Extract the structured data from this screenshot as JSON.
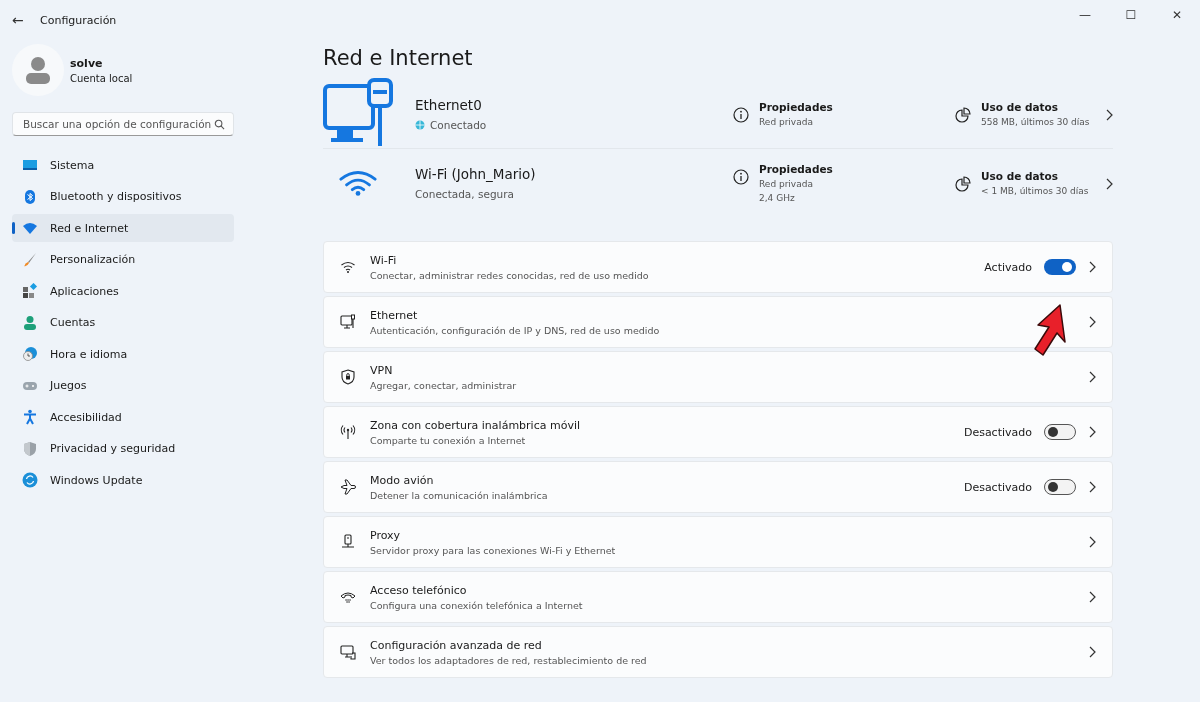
{
  "window": {
    "title": "Configuración",
    "back": "←",
    "controls": [
      "—",
      "☐",
      "✕"
    ]
  },
  "profile": {
    "name": "solve",
    "account": "Cuenta local"
  },
  "search": {
    "placeholder": "Buscar una opción de configuración"
  },
  "sidebar": {
    "items": [
      {
        "label": "Sistema",
        "selected": false
      },
      {
        "label": "Bluetooth y dispositivos",
        "selected": false
      },
      {
        "label": "Red e Internet",
        "selected": true
      },
      {
        "label": "Personalización",
        "selected": false
      },
      {
        "label": "Aplicaciones",
        "selected": false
      },
      {
        "label": "Cuentas",
        "selected": false
      },
      {
        "label": "Hora e idioma",
        "selected": false
      },
      {
        "label": "Juegos",
        "selected": false
      },
      {
        "label": "Accesibilidad",
        "selected": false
      },
      {
        "label": "Privacidad y seguridad",
        "selected": false
      },
      {
        "label": "Windows Update",
        "selected": false
      }
    ]
  },
  "page_title": "Red e Internet",
  "connections": [
    {
      "kind": "ethernet",
      "name": "Ethernet0",
      "status": "Conectado",
      "properties_label": "Propiedades",
      "properties": [
        "Red privada"
      ],
      "usage_label": "Uso de datos",
      "usage": "558 MB, últimos 30 días"
    },
    {
      "kind": "wifi",
      "name": "Wi-Fi (John_Mario)",
      "status": "Conectada, segura",
      "properties_label": "Propiedades",
      "properties": [
        "Red privada",
        "2,4 GHz"
      ],
      "usage_label": "Uso de datos",
      "usage": "< 1 MB, últimos 30 días"
    }
  ],
  "settings": [
    {
      "kind": "toggle",
      "title": "Wi-Fi",
      "subtitle": "Conectar, administrar redes conocidas, red de uso medido",
      "status": "Activado",
      "on": true
    },
    {
      "kind": "link",
      "title": "Ethernet",
      "subtitle": "Autenticación, configuración de IP y DNS, red de uso medido"
    },
    {
      "kind": "link",
      "title": "VPN",
      "subtitle": "Agregar, conectar, administrar"
    },
    {
      "kind": "toggle",
      "title": "Zona con cobertura inalámbrica móvil",
      "subtitle": "Comparte tu conexión a Internet",
      "status": "Desactivado",
      "on": false
    },
    {
      "kind": "toggle",
      "title": "Modo avión",
      "subtitle": "Detener la comunicación inalámbrica",
      "status": "Desactivado",
      "on": false
    },
    {
      "kind": "link",
      "title": "Proxy",
      "subtitle": "Servidor proxy para las conexiones Wi-Fi y Ethernet"
    },
    {
      "kind": "link",
      "title": "Acceso telefónico",
      "subtitle": "Configura una conexión telefónica a Internet"
    },
    {
      "kind": "link",
      "title": "Configuración avanzada de red",
      "subtitle": "Ver todos los adaptadores de red, restablecimiento de red"
    }
  ]
}
